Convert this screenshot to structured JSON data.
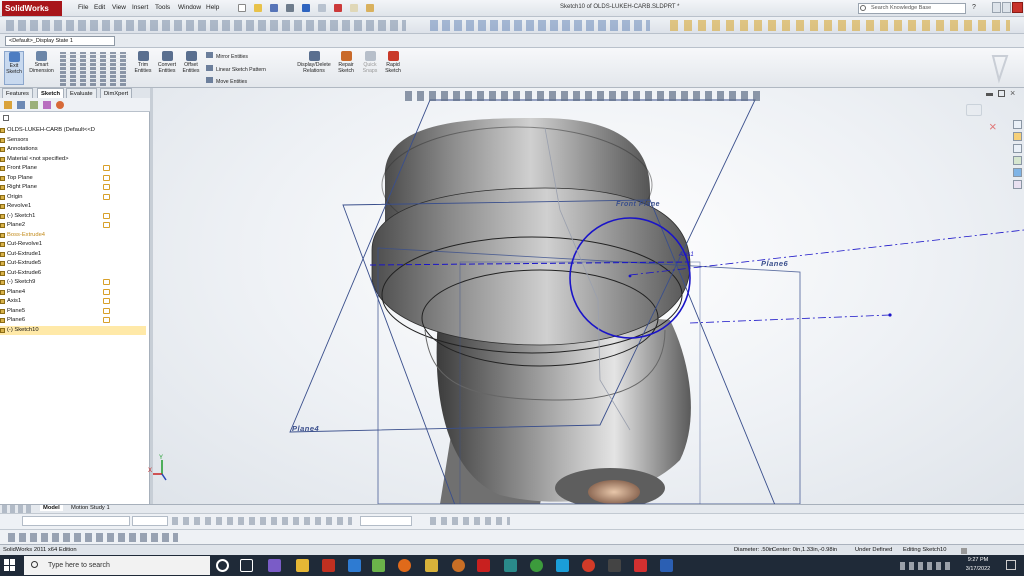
{
  "app": {
    "logo": "SolidWorks",
    "window_title": "Sketch10 of OLDS-LUKEH-CARB.SLDPRT *",
    "menu": [
      "File",
      "Edit",
      "View",
      "Insert",
      "Tools",
      "Window",
      "Help"
    ],
    "search_placeholder": "Search Knowledge Base"
  },
  "display_state": "<Default>_Display State 1",
  "command_manager": {
    "buttons": [
      {
        "label": "Exit Sketch",
        "icon": "exit-sketch-icon"
      },
      {
        "label": "Smart Dimension",
        "icon": "smart-dimension-icon"
      },
      {
        "label": "Trim Entities",
        "icon": "trim-icon"
      },
      {
        "label": "Convert Entities",
        "icon": "convert-icon"
      },
      {
        "label": "Offset Entities",
        "icon": "offset-icon"
      },
      {
        "label": "Display/Delete Relations",
        "icon": "relations-icon"
      },
      {
        "label": "Repair Sketch",
        "icon": "repair-icon"
      },
      {
        "label": "Quick Snaps",
        "icon": "snaps-icon"
      },
      {
        "label": "Rapid Sketch",
        "icon": "rapid-sketch-icon"
      }
    ],
    "row_items": [
      "Mirror Entities",
      "Linear Sketch Pattern",
      "Move Entities"
    ]
  },
  "panel_tabs": [
    "Features",
    "Sketch",
    "Evaluate",
    "DimXpert"
  ],
  "feature_tree": [
    {
      "label": "OLDS-LUKEH-CARB  (Default<<D",
      "tag": false
    },
    {
      "label": "Sensors",
      "tag": false
    },
    {
      "label": "Annotations",
      "tag": false
    },
    {
      "label": "Material <not specified>",
      "tag": false
    },
    {
      "label": "Front Plane",
      "tag": true
    },
    {
      "label": "Top Plane",
      "tag": true
    },
    {
      "label": "Right Plane",
      "tag": true
    },
    {
      "label": "Origin",
      "tag": true
    },
    {
      "label": "Revolve1",
      "tag": false
    },
    {
      "label": "(-) Sketch1",
      "tag": true
    },
    {
      "label": "Plane2",
      "tag": true
    },
    {
      "label": "Boss-Extrude4",
      "tag": false
    },
    {
      "label": "Cut-Revolve1",
      "tag": false
    },
    {
      "label": "Cut-Extrude1",
      "tag": false
    },
    {
      "label": "Cut-Extrude5",
      "tag": false
    },
    {
      "label": "Cut-Extrude6",
      "tag": false
    },
    {
      "label": "(-) Sketch9",
      "tag": true
    },
    {
      "label": "Plane4",
      "tag": true
    },
    {
      "label": "Axis1",
      "tag": true
    },
    {
      "label": "Plane5",
      "tag": true
    },
    {
      "label": "Plane6",
      "tag": true
    },
    {
      "label": "(-) Sketch10",
      "tag": false
    }
  ],
  "viewport": {
    "labels": {
      "front_plane": "Front Plane",
      "plane6": "Plane6",
      "plane4": "Plane4",
      "axis1": "Axis1"
    },
    "triad": {
      "x": "X",
      "y": "Y"
    }
  },
  "bottom_tabs": [
    "Model",
    "Motion Study 1"
  ],
  "status": {
    "edition": "SolidWorks 2011 x64 Edition",
    "diameter": "Diameter: .50in",
    "center": "Center: 0in,1.33in,-0.98in",
    "defined": "Under Defined",
    "editing": "Editing Sketch10"
  },
  "taskbar": {
    "search_placeholder": "Type here to search",
    "time": "9:27 PM",
    "date": "3/17/2022"
  },
  "colors": {
    "brand": "#a8151a",
    "sketch_blue": "#1a14c8",
    "plane_line": "#3a4f8c",
    "selection": "#ffe9a8"
  }
}
